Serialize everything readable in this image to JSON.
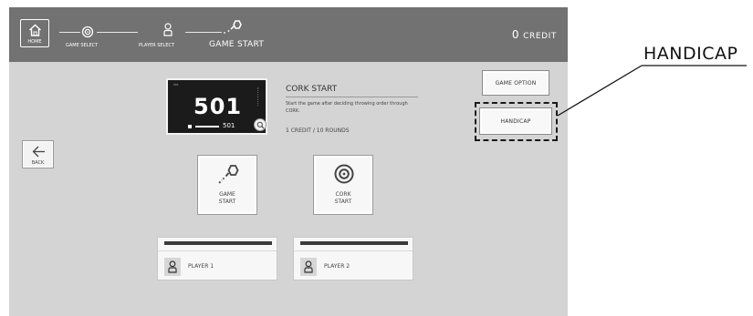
{
  "topbar": {
    "home_label": "HOME",
    "steps": [
      {
        "label": "GAME SELECT",
        "icon": "target-icon"
      },
      {
        "label": "PLAYER SELECT",
        "icon": "person-icon"
      },
      {
        "label": "GAME START",
        "icon": "dart-icon",
        "active": true
      }
    ],
    "credit_count": "0",
    "credit_label": "CREDIT"
  },
  "back_label": "BACK",
  "preview": {
    "score": "501",
    "mini_score": "501",
    "header_text": "501"
  },
  "description": {
    "title": "CORK START",
    "body": "Start the game after deciding throwing order through CORK.",
    "info": "1 CREDIT / 10 ROUNDS"
  },
  "options": {
    "game_option_label": "GAME OPTION",
    "handicap_label": "HANDICAP"
  },
  "tiles": [
    {
      "line1": "GAME",
      "line2": "START",
      "icon": "dart-icon"
    },
    {
      "line1": "CORK",
      "line2": "START",
      "icon": "target-icon"
    }
  ],
  "players": [
    {
      "name": "PLAYER 1"
    },
    {
      "name": "PLAYER 2"
    }
  ],
  "callout": {
    "label": "HANDICAP"
  },
  "colors": {
    "topbar": "#727272",
    "panel": "#d4d4d4",
    "tile": "#f7f7f7"
  }
}
